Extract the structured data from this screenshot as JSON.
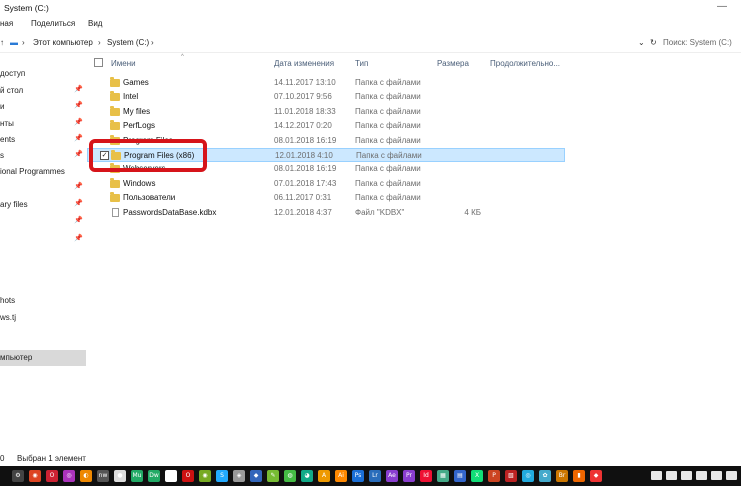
{
  "window": {
    "title": "System (C:)",
    "minimize": "—"
  },
  "ribbon": {
    "tab_home": "ная",
    "tab_share": "Поделиться",
    "tab_view": "Вид"
  },
  "address": {
    "path": [
      "Этот компьютер",
      "System (C:)"
    ],
    "search_placeholder": "Поиск: System (C:)"
  },
  "sidebar": {
    "items": [
      {
        "label": "доступ",
        "pinned": false
      },
      {
        "label": "й стол",
        "pinned": true
      },
      {
        "label": "и",
        "pinned": true
      },
      {
        "label": "нты",
        "pinned": true
      },
      {
        "label": "ents",
        "pinned": true
      },
      {
        "label": "s",
        "pinned": true
      },
      {
        "label": "ional Programmes",
        "pinned": true
      },
      {
        "label": "",
        "pinned": true
      },
      {
        "label": "ary files",
        "pinned": true
      },
      {
        "label": "",
        "pinned": true
      },
      {
        "label": "",
        "pinned": true
      },
      {
        "label": "hots",
        "pinned": false
      },
      {
        "label": "ws.tj",
        "pinned": false
      },
      {
        "label": "мпьютер",
        "pinned": false
      }
    ],
    "pin_glyph": "📌"
  },
  "columns": {
    "name": "Имени",
    "date": "Дата изменения",
    "type": "Тип",
    "size": "Размера",
    "duration": "Продолжительно..."
  },
  "files": [
    {
      "name": "Games",
      "date": "14.11.2017 13:10",
      "type": "Папка с файлами",
      "size": "",
      "kind": "folder"
    },
    {
      "name": "Intel",
      "date": "07.10.2017 9:56",
      "type": "Папка с файлами",
      "size": "",
      "kind": "folder"
    },
    {
      "name": "My files",
      "date": "11.01.2018 18:33",
      "type": "Папка с файлами",
      "size": "",
      "kind": "folder"
    },
    {
      "name": "PerfLogs",
      "date": "14.12.2017 0:20",
      "type": "Папка с файлами",
      "size": "",
      "kind": "folder"
    },
    {
      "name": "Program Files",
      "date": "08.01.2018 16:19",
      "type": "Папка с файлами",
      "size": "",
      "kind": "folder"
    },
    {
      "name": "Program Files (x86)",
      "date": "12.01.2018 4:10",
      "type": "Папка с файлами",
      "size": "",
      "kind": "folder",
      "selected": true
    },
    {
      "name": "Webservers",
      "date": "08.01.2018 16:19",
      "type": "Папка с файлами",
      "size": "",
      "kind": "folder"
    },
    {
      "name": "Windows",
      "date": "07.01.2018 17:43",
      "type": "Папка с файлами",
      "size": "",
      "kind": "folder"
    },
    {
      "name": "Пользователи",
      "date": "06.11.2017 0:31",
      "type": "Папка с файлами",
      "size": "",
      "kind": "folder"
    },
    {
      "name": "PasswordsDataBase.kdbx",
      "date": "12.01.2018 4:37",
      "type": "Файл \"KDBX\"",
      "size": "4 КБ",
      "kind": "file"
    }
  ],
  "status": {
    "count": "0",
    "selection": "Выбран 1 элемент"
  },
  "taskbar": {
    "apps": [
      "⚙",
      "◉",
      "O",
      "◎",
      "◐",
      "nw",
      "●",
      "Mu",
      "Dw",
      "◌",
      "O",
      "◉",
      "S",
      "◈",
      "◆",
      "✎",
      "◍",
      "◕",
      "A",
      "Ai",
      "Ps",
      "Lr",
      "Ae",
      "Pr",
      "Id",
      "▦",
      "▤",
      "X",
      "P",
      "▧",
      "◎",
      "✿",
      "Br",
      "▮",
      "◆"
    ],
    "colors": [
      "#444",
      "#d42",
      "#c23",
      "#a3b",
      "#e80",
      "#555",
      "#ddd",
      "#2a6",
      "#2a6",
      "#fff",
      "#c11",
      "#7a2",
      "#2af",
      "#999",
      "#36b",
      "#7b3",
      "#4b4",
      "#1a8",
      "#e90",
      "#f80",
      "#1b6fd6",
      "#2a6dbb",
      "#8a3ecf",
      "#8a3ecf",
      "#e13",
      "#4a8",
      "#36c",
      "#1d7",
      "#c42",
      "#b22",
      "#2ad",
      "#4ac",
      "#c70",
      "#e60",
      "#e33"
    ]
  }
}
